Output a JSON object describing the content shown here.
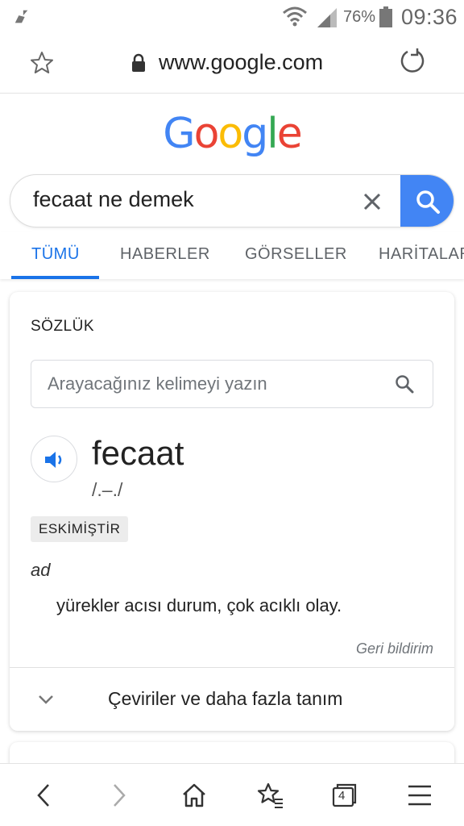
{
  "status_bar": {
    "battery_percent": "76%",
    "time": "09:36"
  },
  "url_bar": {
    "url": "www.google.com"
  },
  "logo": {
    "letters": [
      "G",
      "o",
      "o",
      "g",
      "l",
      "e"
    ],
    "colors": [
      "#4285f4",
      "#ea4335",
      "#fbbc05",
      "#4285f4",
      "#34a853",
      "#ea4335"
    ]
  },
  "search": {
    "query": "fecaat ne demek"
  },
  "tabs": [
    {
      "label": "TÜMÜ",
      "active": true
    },
    {
      "label": "HABERLER",
      "active": false
    },
    {
      "label": "GÖRSELLER",
      "active": false
    },
    {
      "label": "HARİTALAR",
      "active": false
    }
  ],
  "dictionary": {
    "section_title": "SÖZLÜK",
    "input_placeholder": "Arayacağınız kelimeyi yazın",
    "word": "fecaat",
    "phonetic": "/.–./",
    "tag": "ESKİMİŞTİR",
    "part_of_speech": "ad",
    "definition": "yürekler acısı durum, çok acıklı olay.",
    "feedback": "Geri bildirim",
    "expand_label": "Çeviriler ve daha fazla tanım"
  },
  "bottom_bar": {
    "tab_count": "4"
  },
  "colors": {
    "accent": "#1a73e8",
    "search_button": "#4285f4"
  }
}
